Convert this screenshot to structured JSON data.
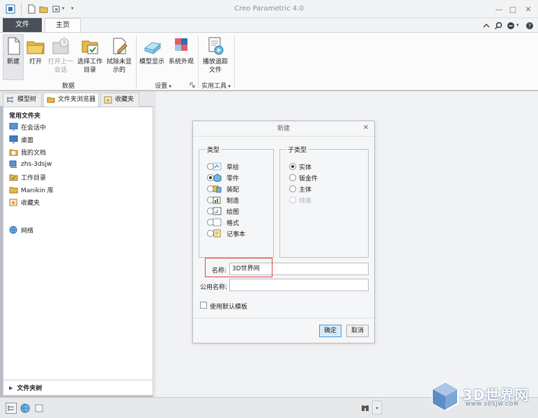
{
  "window": {
    "title": "Creo Parametric 4.0",
    "controls": [
      "—",
      "□",
      "✕"
    ]
  },
  "tabs": {
    "file": "文件",
    "home": "主页"
  },
  "ribbon": {
    "new": "新建",
    "open": "打开",
    "open_last_line1": "打开上一",
    "open_last_line2": "会话",
    "select_wd_line1": "选择工作",
    "select_wd_line2": "目录",
    "erase_line1": "拭除未显",
    "erase_line2": "示的",
    "model_display": "模型显示",
    "system_appearance": "系统外观",
    "play_trail_line1": "播放追踪",
    "play_trail_line2": "文件",
    "group_data": "数据",
    "group_settings": "设置",
    "group_utilities": "实用工具"
  },
  "navigator": {
    "tabs": [
      "模型树",
      "文件夹浏览器",
      "收藏夹"
    ],
    "section": "常用文件夹",
    "favorites": [
      "在会话中",
      "桌面",
      "我的文档",
      "zhs-3dsjw",
      "工作目录",
      "Manikin 库",
      "收藏夹"
    ],
    "network": "网络",
    "folder_tree": "文件夹树"
  },
  "dialog": {
    "title": "新建",
    "type_label": "类型",
    "types": [
      {
        "label": "草绘",
        "selected": false
      },
      {
        "label": "零件",
        "selected": true
      },
      {
        "label": "装配",
        "selected": false
      },
      {
        "label": "制造",
        "selected": false
      },
      {
        "label": "绘图",
        "selected": false
      },
      {
        "label": "格式",
        "selected": false
      },
      {
        "label": "记事本",
        "selected": false
      }
    ],
    "subtype_label": "子类型",
    "subtypes": [
      {
        "label": "实体",
        "selected": true,
        "disabled": false
      },
      {
        "label": "钣金件",
        "selected": false,
        "disabled": false
      },
      {
        "label": "主体",
        "selected": false,
        "disabled": false
      },
      {
        "label": "线束",
        "selected": false,
        "disabled": true
      }
    ],
    "name_label": "名称:",
    "name_value": "3D世界网",
    "common_name_label": "公用名称:",
    "common_name_value": "",
    "use_default_template": "使用默认模板",
    "ok": "确定",
    "cancel": "取消"
  },
  "watermark": {
    "title": "3D世界网",
    "url": "WWW.3DSJW.COM"
  },
  "colors": {
    "file_tab": "#49505a",
    "highlight_box": "#e0413a",
    "primary_button_border": "#4f95d1"
  }
}
